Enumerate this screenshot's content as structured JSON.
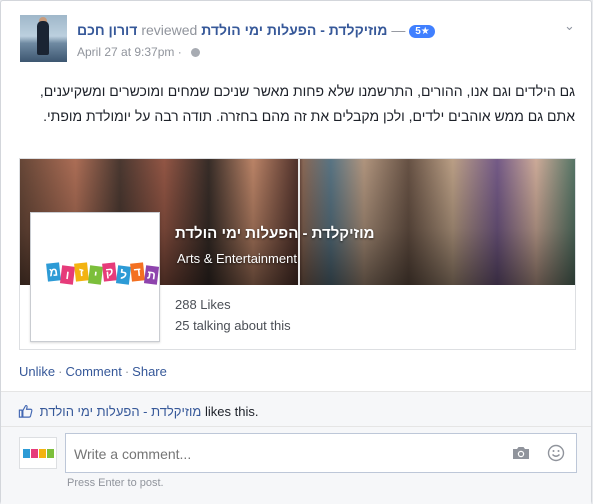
{
  "post": {
    "author": "דורון חכם",
    "verb": "reviewed",
    "page_name": "מוזיקלדת - הפעלות ימי הולדת",
    "separator": "—",
    "rating": "5★",
    "timestamp": "April 27 at 9:37pm",
    "timestamp_sep": "·",
    "body": "גם הילדים וגם אנו, ההורים, התרשמנו שלא פחות מאשר שניכם שמחים ומוכשרים ומשקיענים, אתם גם ממש אוהבים ילדים, ולכן מקבלים את זה מהם בחזרה. תודה רבה על יומולדת מופתי."
  },
  "shared_page": {
    "title": "מוזיקלדת - הפעלות ימי הולדת",
    "category": "Arts & Entertainment",
    "likes": "288 Likes",
    "talking": "25 talking about this",
    "logo_letters": [
      "מ",
      "ו",
      "ז",
      "י",
      "ק",
      "ל",
      "ד",
      "ת"
    ],
    "logo_colors": [
      "#2d9bd6",
      "#e63b7a",
      "#f3b311",
      "#7cbf3b",
      "#e63b7a",
      "#2d9bd6",
      "#f37021",
      "#8e44ad"
    ]
  },
  "actions": {
    "unlike": "Unlike",
    "comment": "Comment",
    "share": "Share",
    "dot": "·"
  },
  "likes_summary": {
    "page": "מוזיקלדת - הפעלות ימי הולדת",
    "suffix": "likes this."
  },
  "comment": {
    "placeholder": "Write a comment...",
    "hint": "Press Enter to post."
  },
  "colors": {
    "link": "#365899",
    "rating_badge": "#4080ff",
    "muted": "#90949c"
  },
  "icons": {
    "menu": "chevron-down-icon",
    "privacy": "globe-icon",
    "like": "thumbs-up-icon",
    "photo": "camera-icon",
    "emoji": "smiley-icon"
  }
}
